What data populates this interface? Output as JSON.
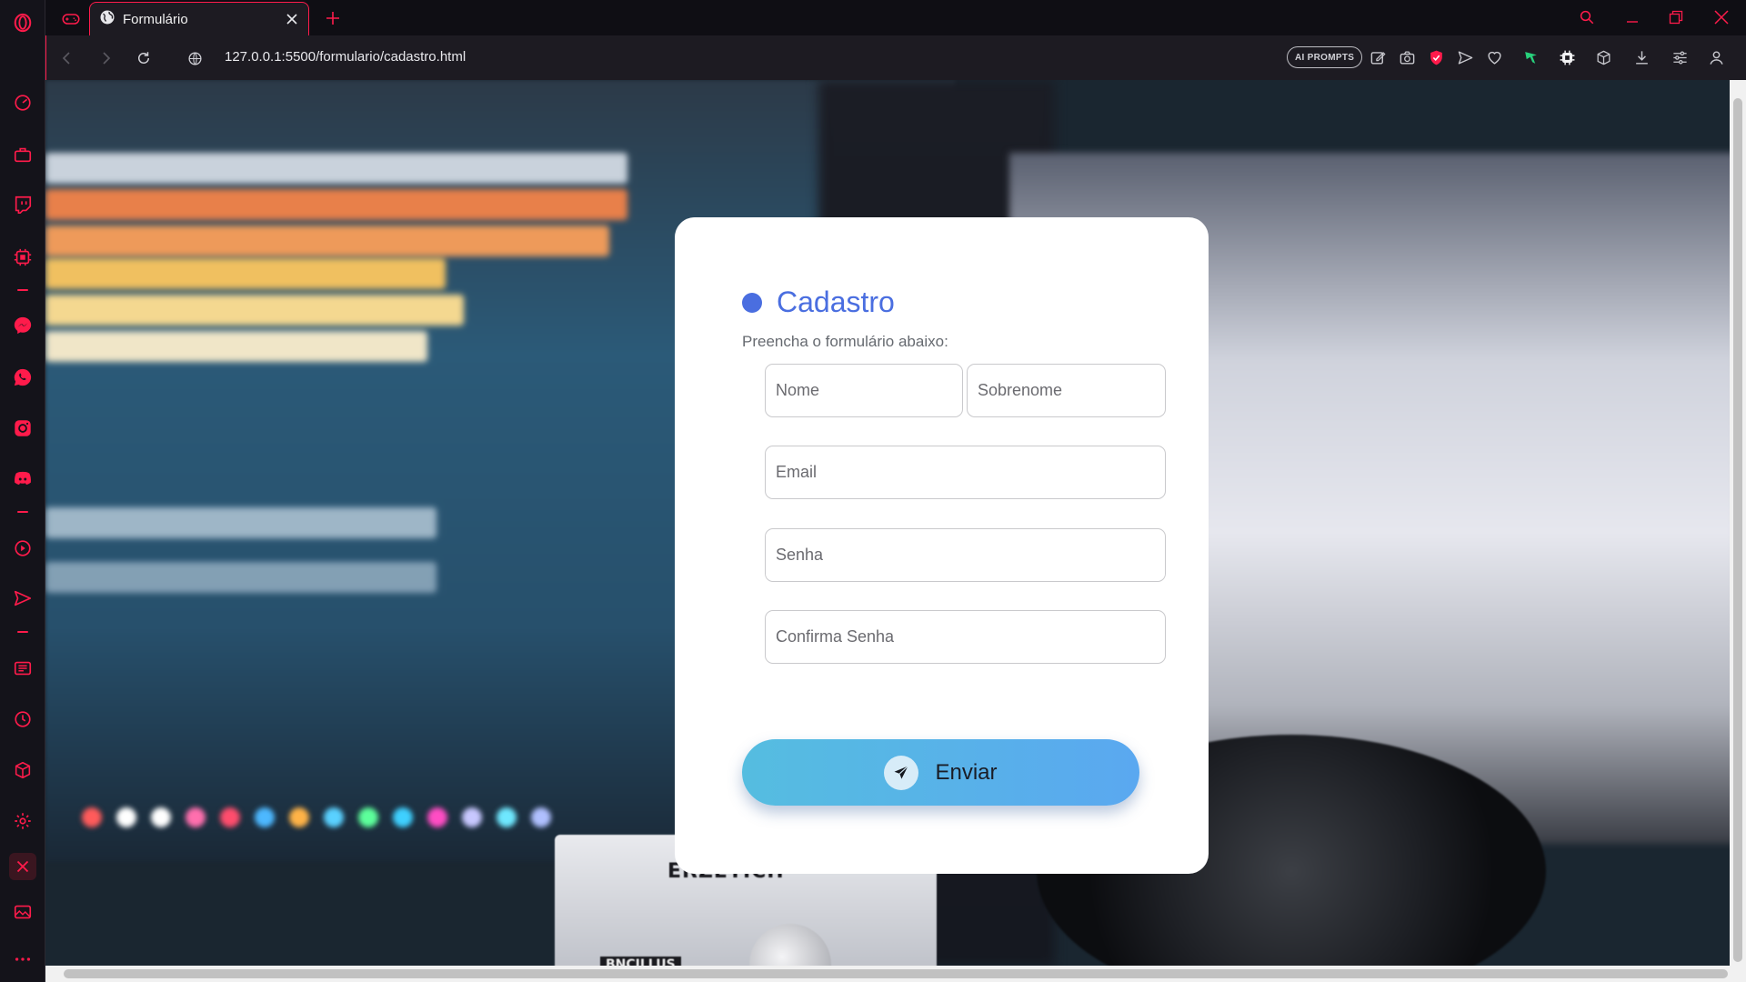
{
  "browser": {
    "tab_title": "Formulário",
    "url": "127.0.0.1:5500/formulario/cadastro.html",
    "ai_prompts_label": "AI PROMPTS",
    "accent_color": "#ff1b4b"
  },
  "sidebar": {
    "items": [
      {
        "name": "opera-logo-icon"
      },
      {
        "name": "speed-dial-icon"
      },
      {
        "name": "briefcase-icon"
      },
      {
        "name": "twitch-icon"
      },
      {
        "name": "chip-icon"
      },
      {
        "name": "messenger-icon"
      },
      {
        "name": "whatsapp-icon"
      },
      {
        "name": "instagram-icon"
      },
      {
        "name": "discord-icon"
      },
      {
        "name": "player-icon"
      },
      {
        "name": "send-icon"
      },
      {
        "name": "news-icon"
      },
      {
        "name": "history-icon"
      },
      {
        "name": "box-icon"
      },
      {
        "name": "settings-icon"
      },
      {
        "name": "crossed-icon"
      },
      {
        "name": "gallery-icon"
      },
      {
        "name": "more-icon"
      }
    ]
  },
  "form": {
    "title": "Cadastro",
    "subtitle": "Preencha o formulário abaixo:",
    "title_color": "#4a6ee0",
    "fields": {
      "nome_placeholder": "Nome",
      "sobrenome_placeholder": "Sobrenome",
      "email_placeholder": "Email",
      "senha_placeholder": "Senha",
      "confirma_placeholder": "Confirma Senha"
    },
    "submit_label": "Enviar"
  },
  "background": {
    "interface_brand": "ERZETICH",
    "interface_model": "BNCILLUS"
  }
}
